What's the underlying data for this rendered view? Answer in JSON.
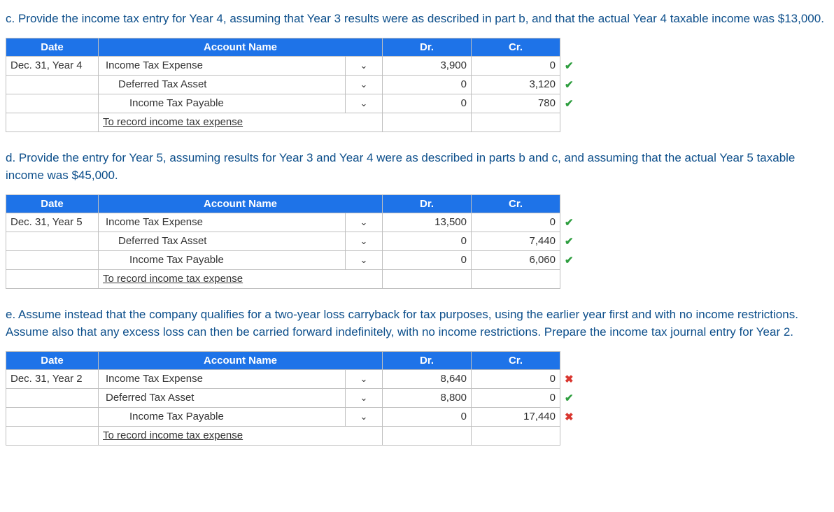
{
  "headers": {
    "date": "Date",
    "account": "Account Name",
    "dr": "Dr.",
    "cr": "Cr."
  },
  "dropdown_glyph": "⌄",
  "mark_ok": "✔",
  "mark_bad": "✖",
  "sections": {
    "c": {
      "prompt": "c. Provide the income tax entry for Year 4, assuming that Year 3 results were as described in part b, and that the actual Year 4 taxable income was $13,000.",
      "rows": [
        {
          "date": "Dec. 31, Year 4",
          "account": "Income Tax Expense",
          "indent": 0,
          "dr": "3,900",
          "cr": "0",
          "mark": "ok"
        },
        {
          "date": "",
          "account": "Deferred Tax Asset",
          "indent": 1,
          "dr": "0",
          "cr": "3,120",
          "mark": "ok"
        },
        {
          "date": "",
          "account": "Income Tax Payable",
          "indent": 2,
          "dr": "0",
          "cr": "780",
          "mark": "ok"
        }
      ],
      "memo": "To record income tax expense"
    },
    "d": {
      "prompt": "d. Provide the entry for Year 5, assuming results for Year 3 and Year 4 were as described in parts b and c, and assuming that the actual Year 5 taxable income was $45,000.",
      "rows": [
        {
          "date": "Dec. 31, Year 5",
          "account": "Income Tax Expense",
          "indent": 0,
          "dr": "13,500",
          "cr": "0",
          "mark": "ok"
        },
        {
          "date": "",
          "account": "Deferred Tax Asset",
          "indent": 1,
          "dr": "0",
          "cr": "7,440",
          "mark": "ok"
        },
        {
          "date": "",
          "account": "Income Tax Payable",
          "indent": 2,
          "dr": "0",
          "cr": "6,060",
          "mark": "ok"
        }
      ],
      "memo": "To record income tax expense"
    },
    "e": {
      "prompt": "e. Assume instead that the company qualifies for a two-year loss carryback for tax purposes, using the earlier year first and with no income restrictions. Assume also that any excess loss can then be carried forward indefinitely, with no income restrictions. Prepare the income tax journal entry for Year 2.",
      "rows": [
        {
          "date": "Dec. 31, Year 2",
          "account": "Income Tax Expense",
          "indent": 0,
          "dr": "8,640",
          "cr": "0",
          "mark": "bad"
        },
        {
          "date": "",
          "account": "Deferred Tax Asset",
          "indent": 0,
          "dr": "8,800",
          "cr": "0",
          "mark": "ok"
        },
        {
          "date": "",
          "account": "Income Tax Payable",
          "indent": 2,
          "dr": "0",
          "cr": "17,440",
          "mark": "bad"
        }
      ],
      "memo": "To record income tax expense"
    }
  }
}
